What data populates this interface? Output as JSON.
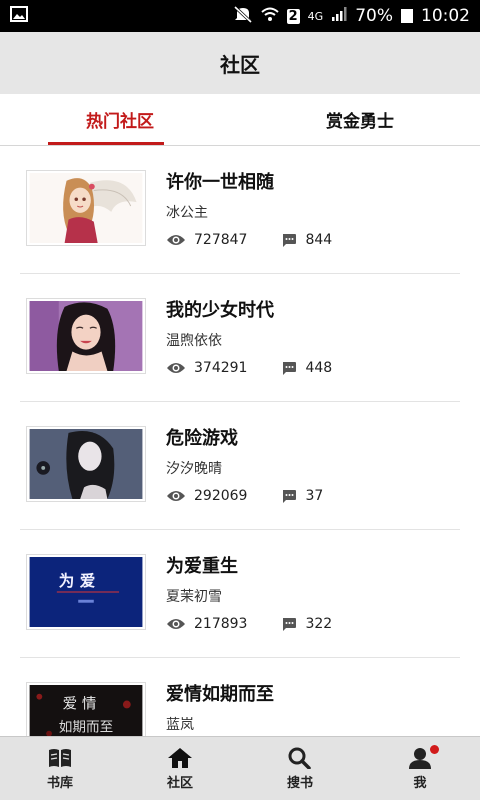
{
  "statusbar": {
    "sim_badge": "2",
    "network": "4G",
    "battery": "70%",
    "time": "10:02"
  },
  "header": {
    "title": "社区"
  },
  "tabs": [
    {
      "label": "热门社区",
      "active": true
    },
    {
      "label": "赏金勇士",
      "active": false
    }
  ],
  "communities": [
    {
      "name": "许你一世相随",
      "author": "冰公主",
      "views": "727847",
      "comments": "844"
    },
    {
      "name": "我的少女时代",
      "author": "温煦依依",
      "views": "374291",
      "comments": "448"
    },
    {
      "name": "危险游戏",
      "author": "汐汐晚晴",
      "views": "292069",
      "comments": "37"
    },
    {
      "name": "为爱重生",
      "author": "夏茉初雪",
      "views": "217893",
      "comments": "322"
    },
    {
      "name": "爱情如期而至",
      "author": "蓝岚",
      "views": "",
      "comments": ""
    }
  ],
  "thumb_texts": [
    "为 爱",
    "爱 情",
    "如期而至"
  ],
  "bottom_nav": [
    {
      "label": "书库",
      "icon": "book-icon"
    },
    {
      "label": "社区",
      "icon": "home-icon"
    },
    {
      "label": "搜书",
      "icon": "search-icon"
    },
    {
      "label": "我",
      "icon": "person-icon"
    }
  ],
  "colors": {
    "accent": "#c21a1a",
    "header_bg": "#e6e6e6",
    "nav_bg": "#e3e3e3"
  }
}
